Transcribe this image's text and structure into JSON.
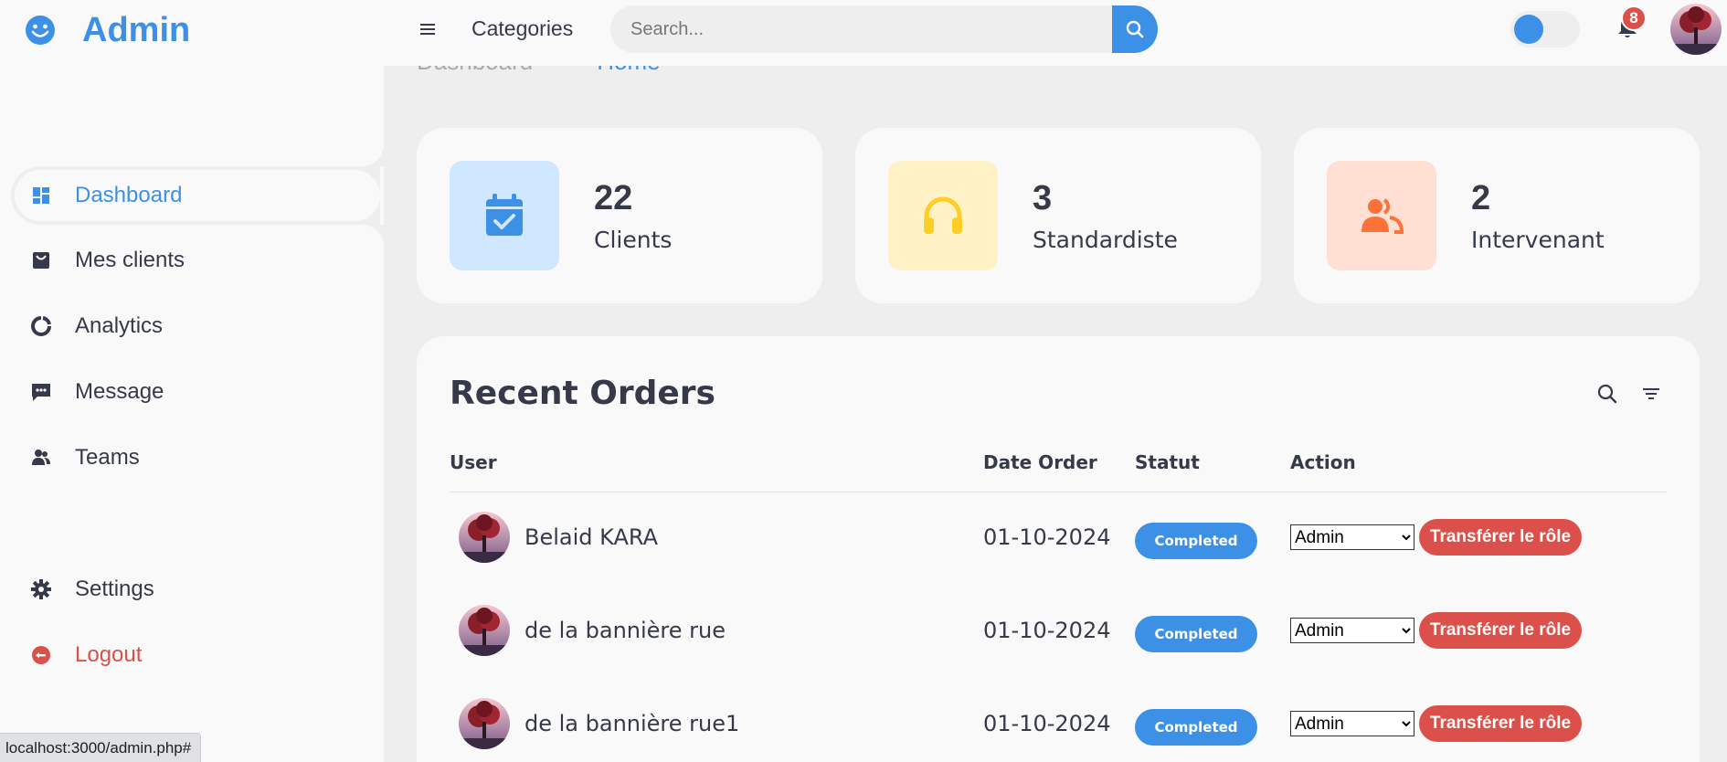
{
  "topnav": {
    "brand_name": "Admin",
    "categories_label": "Categories",
    "search_placeholder": "Search...",
    "notification_count": "8",
    "theme_toggle_on": false
  },
  "sidebar": {
    "items": [
      {
        "label": "Dashboard",
        "icon": "dashboard-icon",
        "active": true
      },
      {
        "label": "Mes clients",
        "icon": "shopping-bag-icon"
      },
      {
        "label": "Analytics",
        "icon": "doughnut-chart-icon"
      },
      {
        "label": "Message",
        "icon": "message-dots-icon"
      },
      {
        "label": "Teams",
        "icon": "group-icon"
      }
    ],
    "settings_label": "Settings",
    "logout_label": "Logout"
  },
  "breadcrumb": {
    "first": "Dashboard",
    "second": "Home"
  },
  "cards": [
    {
      "value": "22",
      "label": "Clients",
      "icon": "calendar-check-icon",
      "bg": "#cfe8ff",
      "fg": "#3c91e6"
    },
    {
      "value": "3",
      "label": "Standardiste",
      "icon": "headphones-icon",
      "bg": "#fff2c6",
      "fg": "#ffce26"
    },
    {
      "value": "2",
      "label": "Intervenant",
      "icon": "group-icon",
      "bg": "#ffe0d3",
      "fg": "#fd7238"
    }
  ],
  "orders": {
    "title": "Recent Orders",
    "columns": {
      "user": "User",
      "date": "Date Order",
      "status": "Statut",
      "action": "Action"
    },
    "rows": [
      {
        "user": "Belaid KARA",
        "date": "01-10-2024",
        "status": "Completed",
        "role": "Admin",
        "button": "Transférer le rôle"
      },
      {
        "user": "de la bannière rue",
        "date": "01-10-2024",
        "status": "Completed",
        "role": "Admin",
        "button": "Transférer le rôle"
      },
      {
        "user": "de la bannière rue1",
        "date": "01-10-2024",
        "status": "Completed",
        "role": "Admin",
        "button": "Transférer le rôle"
      }
    ]
  },
  "statusbar": {
    "url": "localhost:3000/admin.php#"
  },
  "colors": {
    "accent": "#3c91e6",
    "danger": "#db504a",
    "light": "#f9f9f9",
    "grey": "#eeeeee",
    "dark": "#363949"
  }
}
